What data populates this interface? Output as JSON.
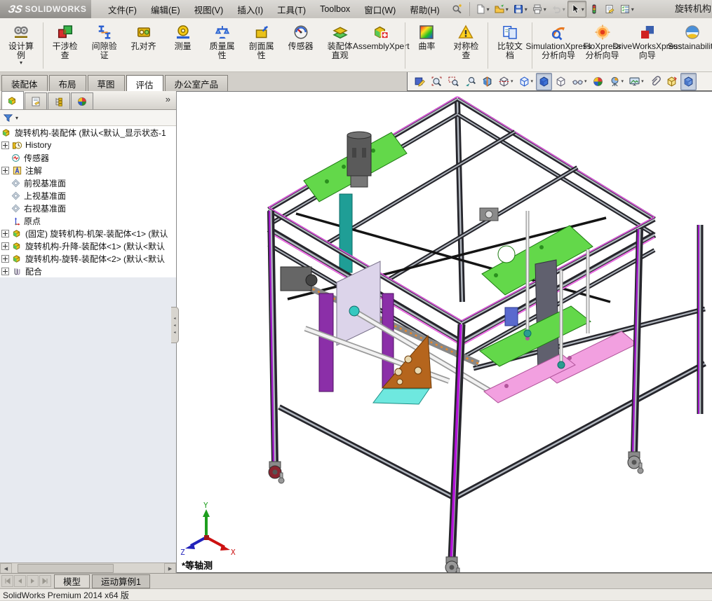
{
  "window": {
    "brand_ds": "ЗS",
    "brand": "SOLIDWORKS",
    "title": "旋转机构"
  },
  "menubar": {
    "items": [
      "文件(F)",
      "编辑(E)",
      "视图(V)",
      "插入(I)",
      "工具(T)",
      "Toolbox",
      "窗口(W)",
      "帮助(H)"
    ]
  },
  "quickbar": {
    "items": [
      {
        "name": "new-document-icon",
        "icon": "qb-new",
        "dropdown": true
      },
      {
        "name": "open-icon",
        "icon": "qb-open",
        "dropdown": true
      },
      {
        "name": "save-icon",
        "icon": "qb-save",
        "dropdown": true
      },
      {
        "name": "print-icon",
        "icon": "qb-print",
        "dropdown": true
      },
      {
        "name": "undo-icon",
        "icon": "qb-undo",
        "dropdown": true,
        "disabled": true
      },
      {
        "name": "select-cursor-icon",
        "icon": "qb-cursor",
        "dropdown": true,
        "pressed": true
      },
      {
        "name": "rebuild-traffic-light-icon",
        "icon": "qb-traffic"
      },
      {
        "name": "file-properties-icon",
        "icon": "qb-props"
      },
      {
        "name": "options-icon",
        "icon": "qb-options",
        "dropdown": true
      }
    ]
  },
  "ribbon": {
    "groups": [
      {
        "items": [
          {
            "name": "design-study-button",
            "label": "设计算\n例",
            "icon": "design-study",
            "dropdown": true
          }
        ]
      },
      {
        "items": [
          {
            "name": "interference-check-button",
            "label": "干涉检\n查",
            "icon": "interference"
          },
          {
            "name": "clearance-verify-button",
            "label": "间隙验\n证",
            "icon": "clearance"
          },
          {
            "name": "hole-alignment-button",
            "label": "孔对齐",
            "icon": "hole-align"
          },
          {
            "name": "measure-button",
            "label": "测量",
            "icon": "measure"
          },
          {
            "name": "mass-properties-button",
            "label": "质量属\n性",
            "icon": "mass-props"
          },
          {
            "name": "section-properties-button",
            "label": "剖面属\n性",
            "icon": "section-props"
          },
          {
            "name": "sensor-button",
            "label": "传感器",
            "icon": "sensor"
          },
          {
            "name": "assembly-visualization-button",
            "label": "装配体\n直观",
            "icon": "assembly-visual"
          },
          {
            "name": "assemblyxpert-button",
            "label": "AssemblyXpert",
            "icon": "assemblyxpert"
          }
        ]
      },
      {
        "items": [
          {
            "name": "curvature-button",
            "label": "曲率",
            "icon": "curvature"
          },
          {
            "name": "symmetry-check-button",
            "label": "对称检\n查",
            "icon": "symmetry"
          }
        ]
      },
      {
        "items": [
          {
            "name": "compare-documents-button",
            "label": "比较文\n档",
            "icon": "compare-docs"
          }
        ]
      },
      {
        "items": [
          {
            "name": "simulationxpress-button",
            "label": "SimulationXpress\n分析向导",
            "icon": "simxpress"
          },
          {
            "name": "floxpress-button",
            "label": "FloXpress\n分析向导",
            "icon": "floxpress"
          },
          {
            "name": "driveworksxpress-button",
            "label": "DriveWorksXpress\n向导",
            "icon": "driveworks"
          },
          {
            "name": "sustainability-button",
            "label": "Sustainability",
            "icon": "sustainability"
          }
        ]
      }
    ]
  },
  "command_tabs": {
    "items": [
      {
        "name": "tab-assembly",
        "label": "装配体"
      },
      {
        "name": "tab-layout",
        "label": "布局"
      },
      {
        "name": "tab-sketch",
        "label": "草图"
      },
      {
        "name": "tab-evaluate",
        "label": "评估",
        "active": true
      },
      {
        "name": "tab-office-products",
        "label": "办公室产品"
      }
    ]
  },
  "headsup": {
    "items": [
      {
        "name": "edit-view-icon",
        "icon": "hu-edit"
      },
      {
        "name": "zoom-to-fit-icon",
        "icon": "hu-zoomfit"
      },
      {
        "name": "zoom-to-area-icon",
        "icon": "hu-zoomarea"
      },
      {
        "name": "previous-view-icon",
        "icon": "hu-prev"
      },
      {
        "name": "section-view-icon",
        "icon": "hu-section"
      },
      {
        "name": "annotation-views-icon",
        "icon": "hu-annot",
        "dropdown": true
      },
      {
        "name": "view-orientation-icon",
        "icon": "hu-orient",
        "dropdown": true
      },
      {
        "name": "display-style-shaded-icon",
        "icon": "hu-shaded",
        "pressed": true
      },
      {
        "name": "display-style-wireframe-icon",
        "icon": "hu-wire"
      },
      {
        "name": "hide-show-items-icon",
        "icon": "hu-glasses",
        "dropdown": true
      },
      {
        "name": "edit-appearance-icon",
        "icon": "hu-appearance"
      },
      {
        "name": "apply-scene-icon",
        "icon": "hu-scene",
        "dropdown": true
      },
      {
        "name": "view-settings-icon",
        "icon": "hu-viewset",
        "dropdown": true
      },
      {
        "name": "attachments-icon",
        "icon": "hu-clip"
      },
      {
        "name": "instant3d-icon",
        "icon": "hu-instant3d"
      },
      {
        "name": "view-cube-icon",
        "icon": "hu-3dcube",
        "pressed": true
      }
    ]
  },
  "feature_panel": {
    "tabs": [
      {
        "name": "featuremanager-tab",
        "icon": "pt-feature",
        "active": true
      },
      {
        "name": "propertymanager-tab",
        "icon": "pt-props"
      },
      {
        "name": "configurationmanager-tab",
        "icon": "pt-config"
      },
      {
        "name": "displaymanager-tab",
        "icon": "pt-display"
      }
    ],
    "overflow": "»",
    "filter": {
      "icon": "funnel"
    },
    "tree": {
      "items": [
        {
          "icon": "tree-assembly",
          "label": "旋转机构-装配体 (默认<默认_显示状态-1",
          "root": true
        },
        {
          "icon": "tree-history",
          "label": "History",
          "expand": true
        },
        {
          "icon": "tree-sensors",
          "label": "传感器"
        },
        {
          "icon": "tree-annot",
          "label": "注解",
          "expand": true
        },
        {
          "icon": "tree-plane",
          "label": "前视基准面"
        },
        {
          "icon": "tree-plane",
          "label": "上视基准面"
        },
        {
          "icon": "tree-plane",
          "label": "右视基准面"
        },
        {
          "icon": "tree-origin",
          "label": "原点"
        },
        {
          "icon": "tree-assembly",
          "label": "(固定) 旋转机构-机架-装配体<1> (默认",
          "expand": true
        },
        {
          "icon": "tree-assembly",
          "label": "旋转机构-升降-装配体<1> (默认<默认",
          "expand": true
        },
        {
          "icon": "tree-assembly",
          "label": "旋转机构-旋转-装配体<2> (默认<默认",
          "expand": true
        },
        {
          "icon": "tree-mates",
          "label": "配合",
          "expand": true
        }
      ]
    }
  },
  "viewport": {
    "view_label": "*等轴测",
    "triad": {
      "x": "X",
      "y": "Y",
      "z": "Z"
    },
    "model_colors": {
      "frame_dark": "#26262c",
      "frame_magenta": "#e04fe0",
      "leg_purple": "#a018c8",
      "plate_green": "#63d84a",
      "plate_pink": "#f2a0e0",
      "plate_orange": "#b5651d",
      "plate_cyan": "#6ee8df",
      "belt_teal": "#1f9e96"
    }
  },
  "bottom_bar": {
    "tabs": [
      {
        "name": "model-tab",
        "label": "模型",
        "active": true
      },
      {
        "name": "motion-study-tab",
        "label": "运动算例1"
      }
    ]
  },
  "statusbar": {
    "text": "SolidWorks Premium 2014 x64 版"
  }
}
